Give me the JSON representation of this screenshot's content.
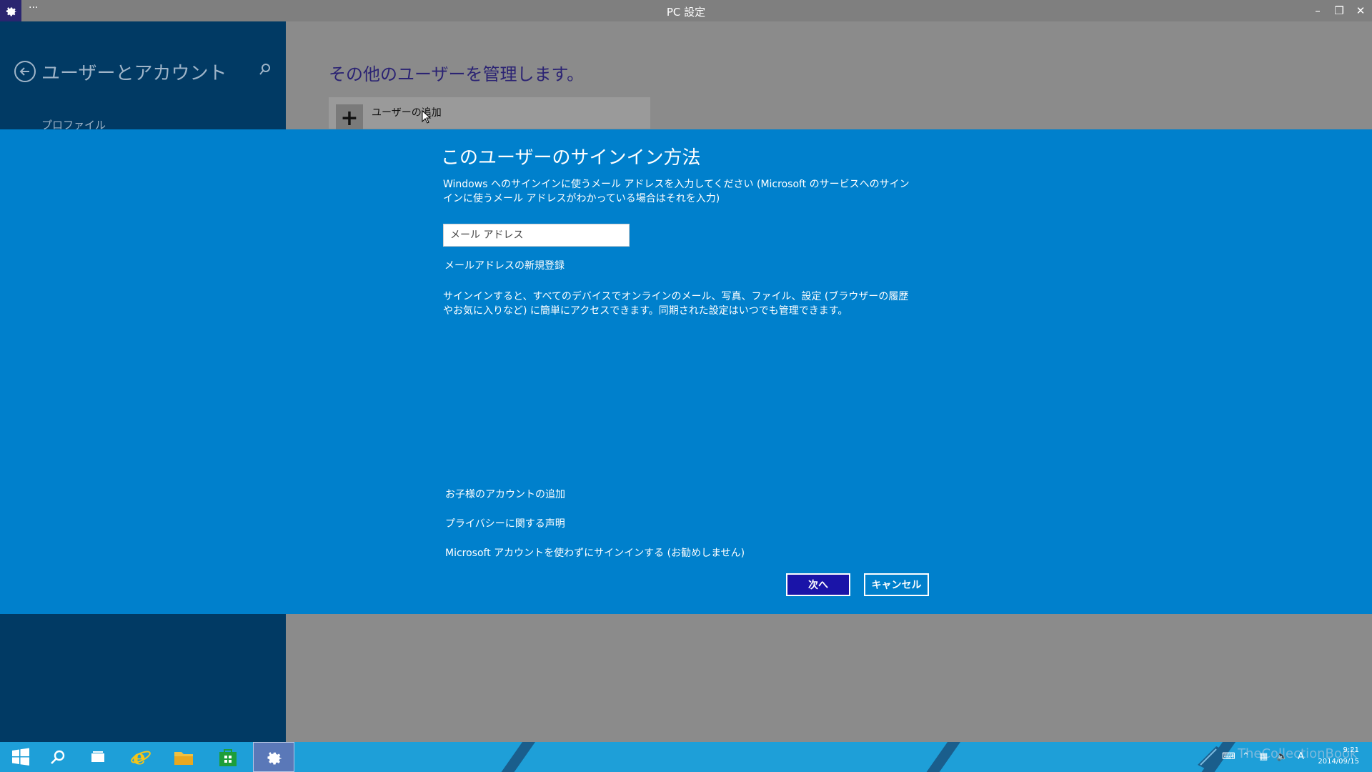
{
  "window": {
    "title": "PC 設定",
    "menu": "···",
    "minimize": "–",
    "restore": "❐",
    "close": "✕"
  },
  "sidebar": {
    "title": "ユーザーとアカウント",
    "items": [
      {
        "label": "プロファイル"
      }
    ]
  },
  "main": {
    "title": "その他のユーザーを管理します。",
    "add_user_label": "ユーザーの追加",
    "add_user_icon": "+"
  },
  "dialog": {
    "title": "このユーザーのサインイン方法",
    "description": "Windows へのサインインに使うメール アドレスを入力してください (Microsoft のサービスへのサインインに使うメール アドレスがわかっている場合はそれを入力)",
    "email_placeholder": "メール アドレス",
    "new_email_link": "メールアドレスの新規登録",
    "info": "サインインすると、すべてのデバイスでオンラインのメール、写真、ファイル、設定 (ブラウザーの履歴やお気に入りなど) に簡単にアクセスできます。同期された設定はいつでも管理できます。",
    "links": [
      "お子様のアカウントの追加",
      "プライバシーに関する声明",
      "Microsoft アカウントを使わずにサインインする (お勧めしません)"
    ],
    "next_button": "次へ",
    "cancel_button": "キャンセル"
  },
  "taskbar": {
    "watermark": "TheCollectionBook",
    "clock_time": "9:21",
    "clock_date": "2014/09/15",
    "ime": "A"
  },
  "colors": {
    "dialog_bg": "#0080cc",
    "sidebar_bg": "#013a64",
    "accent_button": "#1a14a8",
    "taskbar_bg": "#1e9fd8"
  }
}
